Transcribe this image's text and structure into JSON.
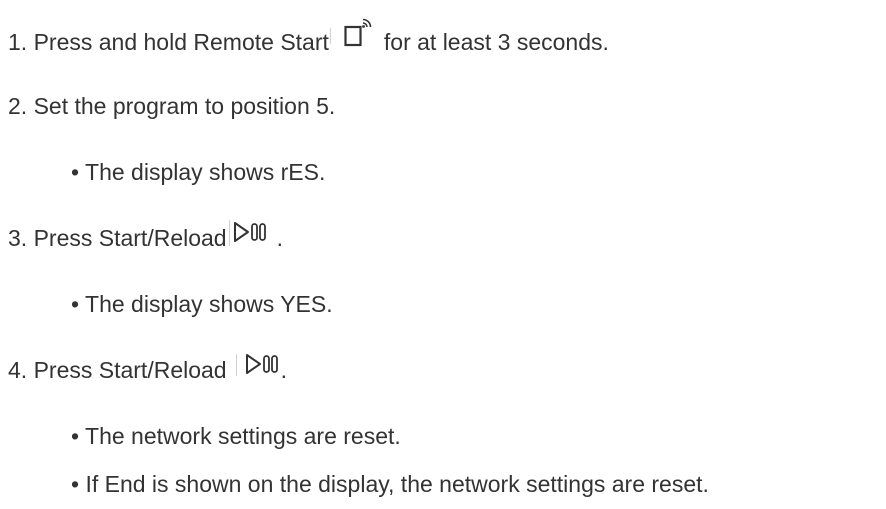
{
  "instructions": {
    "step1": {
      "before": "1. Press and hold Remote Start",
      "icon": "remote-start-icon",
      "after": "for at least 3 seconds."
    },
    "step2": {
      "text": "2. Set the program to position 5."
    },
    "bullet1": {
      "text": "• The display shows rES."
    },
    "step3": {
      "before": "3. Press Start/Reload",
      "icon": "start-reload-icon",
      "after": "."
    },
    "bullet2": {
      "text": "• The display shows YES."
    },
    "step4": {
      "before": "4. Press Start/Reload",
      "icon": "start-reload-icon",
      "after": "."
    },
    "bullet3": {
      "text": "• The network settings are reset."
    },
    "bullet4": {
      "text": "• If End is shown on the display, the network settings are reset."
    }
  }
}
